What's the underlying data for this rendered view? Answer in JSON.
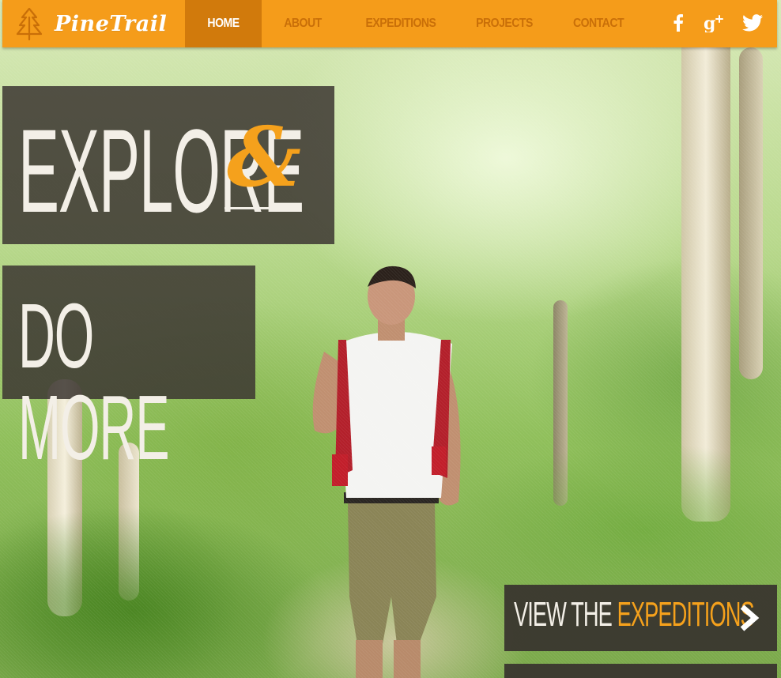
{
  "brand": {
    "name": "PineTrail",
    "logo_icon": "pine-tree-icon"
  },
  "nav": {
    "items": [
      {
        "label": "HOME",
        "active": true
      },
      {
        "label": "ABOUT",
        "active": false
      },
      {
        "label": "EXPEDITIONS",
        "active": false
      },
      {
        "label": "PROJECTS",
        "active": false
      },
      {
        "label": "CONTACT",
        "active": false
      }
    ],
    "social": [
      "facebook-icon",
      "google-plus-icon",
      "twitter-icon"
    ]
  },
  "hero": {
    "line1": "EXPLORE",
    "ampersand": "&",
    "line2": "DO MORE"
  },
  "cta": {
    "prefix": "VIEW THE ",
    "highlight": "EXPEDITIONS",
    "arrow_icon": "chevron-right-icon"
  },
  "colors": {
    "accent": "#f59c1a",
    "accent_dark": "#d17a0c",
    "panel": "#3c3732",
    "text_light": "#f3efe7"
  }
}
